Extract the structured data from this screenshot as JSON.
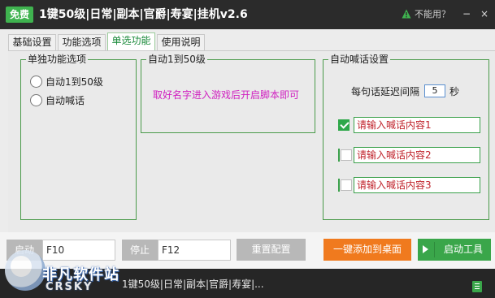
{
  "title_bar": {
    "badge": "免费",
    "title": "1键50级|日常|副本|官爵|寿宴|挂机v2.6",
    "help_link": "不能用？",
    "minimize": "−",
    "close": "×"
  },
  "tabs": [
    {
      "label": "基础设置",
      "active": false
    },
    {
      "label": "功能选项",
      "active": false
    },
    {
      "label": "单选功能",
      "active": true
    },
    {
      "label": "使用说明",
      "active": false
    }
  ],
  "single_options": {
    "title": "单独功能选项",
    "options": [
      {
        "label": "自动1到50级",
        "selected": false
      },
      {
        "label": "自动喊话",
        "selected": false
      }
    ]
  },
  "auto_level": {
    "title": "自动1到50级",
    "hint": "取好名字进入游戏后开启脚本即可"
  },
  "auto_shout": {
    "title": "自动喊话设置",
    "delay_label": "每句话延迟间隔",
    "delay_value": "5",
    "delay_unit": "秒",
    "lines": [
      {
        "checked": true,
        "value": "请输入喊话内容1"
      },
      {
        "checked": false,
        "value": "请输入喊话内容2"
      },
      {
        "checked": false,
        "value": "请输入喊话内容3"
      }
    ]
  },
  "controls": {
    "start_label": "启动",
    "start_key": "F10",
    "stop_label": "停止",
    "stop_key": "F12",
    "reset": "重置配置",
    "add_desktop": "一键添加到桌面",
    "start_tool": "启动工具"
  },
  "status_bar": {
    "text": "1键50级|日常|副本|官爵|寿宴|..."
  },
  "watermark": {
    "cn": "非凡软件站",
    "en": "CRSKY"
  },
  "colors": {
    "accent_green": "#3aa64a",
    "orange": "#f07a1e",
    "hint_magenta": "#d020c0",
    "input_red_text": "#c0232b"
  }
}
